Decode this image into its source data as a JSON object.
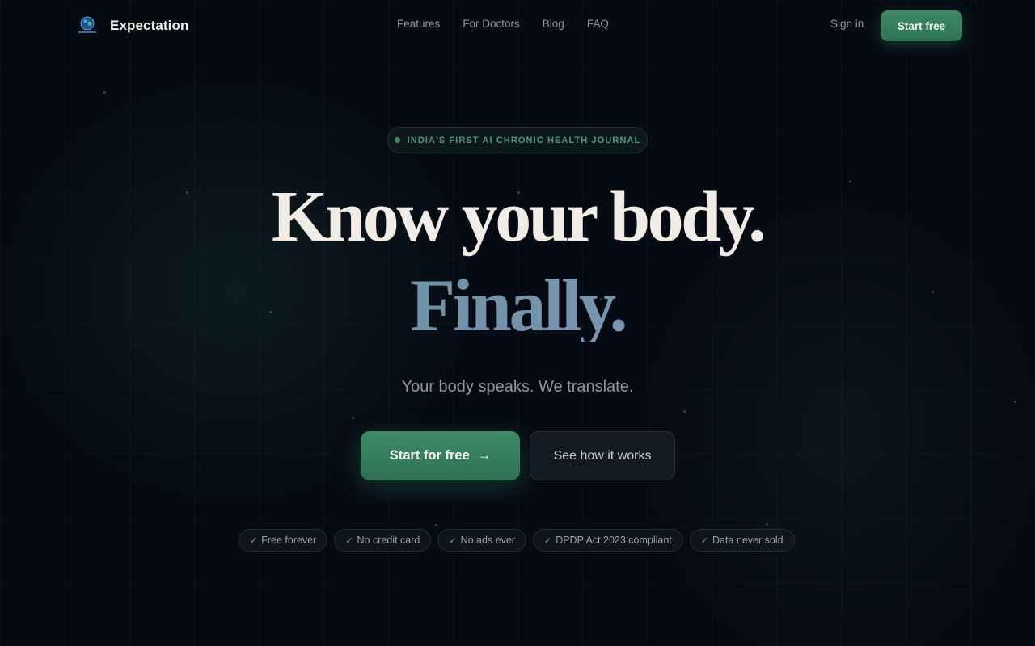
{
  "nav": {
    "brand_name": "Expectation",
    "logo_icon": "globe-logo-icon",
    "links": [
      "Features",
      "For Doctors",
      "Blog",
      "FAQ"
    ],
    "sign_in": "Sign in",
    "start_button": "Start free"
  },
  "hero": {
    "badge": "INDIA'S FIRST AI CHRONIC HEALTH JOURNAL",
    "headline_line1": "Know your body.",
    "headline_line2": "Finally.",
    "subtitle": "Your body speaks. We translate.",
    "primary_cta": "Start for free",
    "primary_cta_arrow": "→",
    "secondary_cta": "See how it works"
  },
  "pills": [
    "Free forever",
    "No credit card",
    "No ads ever",
    "DPDP Act 2023 compliant",
    "Data never sold"
  ],
  "pill_check": "✓",
  "colors": {
    "background": "#060b13",
    "accent_green": "#3e8b66",
    "headline": "#f1ede6",
    "gradient_text_start": "#5e8a93",
    "gradient_text_end": "#8aa2c8",
    "muted_text": "#8e96a3"
  }
}
